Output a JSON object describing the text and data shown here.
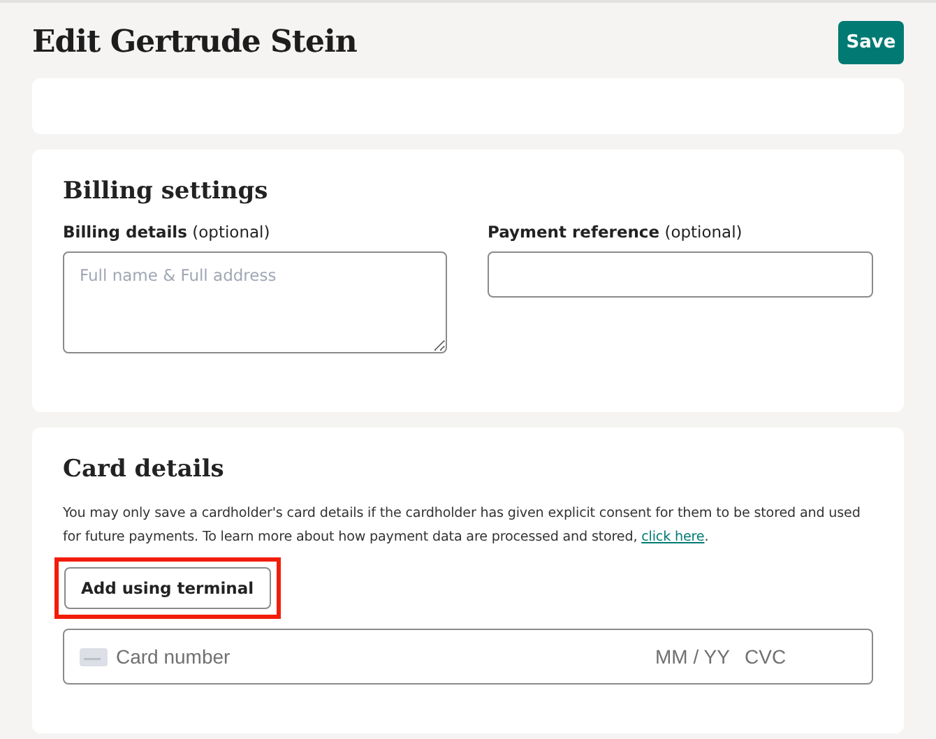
{
  "header": {
    "title": "Edit Gertrude Stein",
    "save_button": "Save"
  },
  "billing": {
    "heading": "Billing settings",
    "fields": [
      {
        "label": "Billing details",
        "hint": "(optional)",
        "kind": "textarea",
        "placeholder": "Full name & Full address"
      },
      {
        "label": "Payment reference",
        "hint": "(optional)",
        "kind": "input"
      }
    ]
  },
  "card": {
    "heading": "Card details",
    "notice": "You may only save a cardholder's card details if the cardholder has given explicit consent for them to be stored and used for future payments. To learn more about how payment data are processed and stored, ",
    "link": "click here",
    "notice_end": ".",
    "terminal_button": {
      "label": "Add using terminal",
      "highlighted": true
    },
    "card_number": {
      "placeholder": "Card number"
    },
    "expiry": {
      "placeholder": "MM / YY"
    },
    "cvc": {
      "placeholder": "CVC"
    }
  }
}
